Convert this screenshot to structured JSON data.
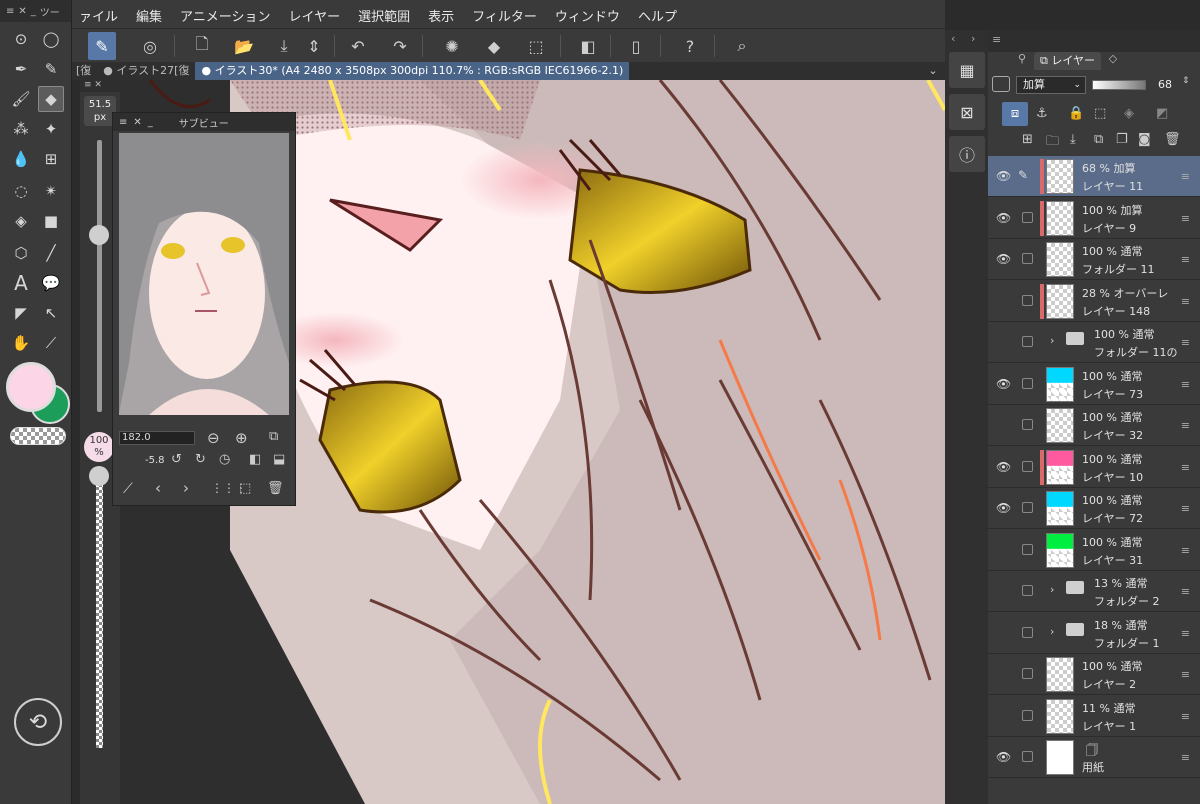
{
  "menu": [
    "ァイル",
    "編集",
    "アニメーション",
    "レイヤー",
    "選択範囲",
    "表示",
    "フィルター",
    "ウィンドウ",
    "ヘルプ"
  ],
  "tool_palette": {
    "title": "ツー"
  },
  "tabs": [
    {
      "label": "[復",
      "active": false
    },
    {
      "label": "● イラスト27[復",
      "active": false
    },
    {
      "label": "● イラスト30* (A4 2480 x 3508px 300dpi 110.7% : RGB:sRGB IEC61966-2.1)",
      "active": true
    }
  ],
  "brush_size": {
    "value": "51.5",
    "unit": "px",
    "slider_fraction": 0.35
  },
  "opacity": {
    "value": "100",
    "unit": "%"
  },
  "subview": {
    "title": "サブビュー",
    "zoom": "182.0",
    "rotation": "-5.8"
  },
  "colors": {
    "main": "#fcd6e6",
    "sub": "#1c9e5a",
    "accent": "#5878a8"
  },
  "layer_panel": {
    "tab_label": "レイヤー",
    "blend_mode": "加算",
    "opacity": "68"
  },
  "layers": [
    {
      "mode": "68 % 加算",
      "name": "レイヤー 11",
      "visible": true,
      "selected": true,
      "red": true,
      "pen": true
    },
    {
      "mode": "100 % 加算",
      "name": "レイヤー 9",
      "visible": true,
      "red": true
    },
    {
      "mode": "100 % 通常",
      "name": "フォルダー 11",
      "visible": true
    },
    {
      "mode": "28 % オーバーレ",
      "name": "レイヤー 148",
      "visible": false,
      "red": true
    },
    {
      "mode": "100 % 通常",
      "name": "フォルダー 11の",
      "visible": false,
      "folder": true
    },
    {
      "mode": "100 % 通常",
      "name": "レイヤー 73",
      "visible": true
    },
    {
      "mode": "100 % 通常",
      "name": "レイヤー 32",
      "visible": false
    },
    {
      "mode": "100 % 通常",
      "name": "レイヤー 10",
      "visible": true,
      "red": true
    },
    {
      "mode": "100 % 通常",
      "name": "レイヤー 72",
      "visible": true
    },
    {
      "mode": "100 % 通常",
      "name": "レイヤー 31",
      "visible": false
    },
    {
      "mode": "13 % 通常",
      "name": "フォルダー 2",
      "visible": false,
      "folder": true
    },
    {
      "mode": "18 % 通常",
      "name": "フォルダー 1",
      "visible": false,
      "folder": true
    },
    {
      "mode": "100 % 通常",
      "name": "レイヤー 2",
      "visible": false
    },
    {
      "mode": "11 % 通常",
      "name": "レイヤー 1",
      "visible": false
    },
    {
      "mode": "",
      "name": "用紙",
      "visible": true,
      "paper": true
    }
  ]
}
